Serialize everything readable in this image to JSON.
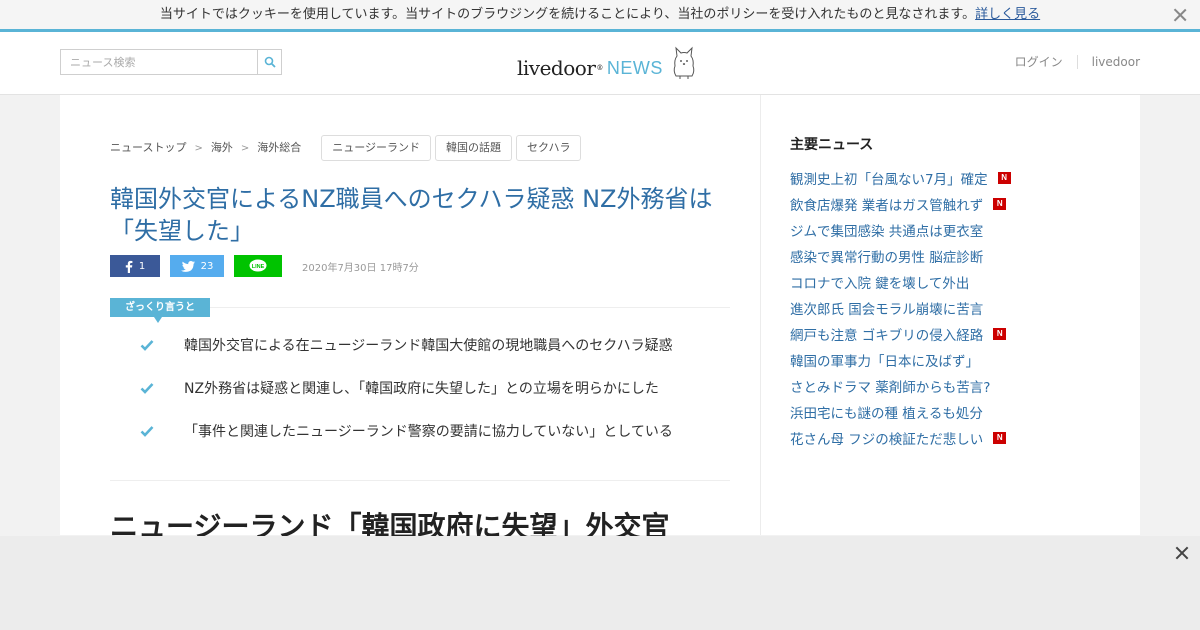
{
  "cookie_bar": {
    "text": "当サイトではクッキーを使用しています。当サイトのブラウジングを続けることにより、当社のポリシーを受け入れたものと見なされます。",
    "link": "詳しく見る"
  },
  "header": {
    "search_placeholder": "ニュース検索",
    "logo_main": "livedoor",
    "logo_sup": "®",
    "logo_news": "NEWS",
    "login": "ログイン",
    "livedoor_link": "livedoor"
  },
  "breadcrumb": [
    "ニューストップ",
    "海外",
    "海外総合"
  ],
  "tags": [
    "ニュージーランド",
    "韓国の話題",
    "セクハラ"
  ],
  "article": {
    "title": "韓国外交官によるNZ職員へのセクハラ疑惑 NZ外務省は「失望した」",
    "share": {
      "fb_count": "1",
      "tw_count": "23"
    },
    "date": "2020年7月30日 17時7分",
    "summary_label": "ざっくり言うと",
    "summary": [
      "韓国外交官による在ニュージーランド韓国大使館の現地職員へのセクハラ疑惑",
      "NZ外務省は疑惑と関連し、「韓国政府に失望した」との立場を明らかにした",
      "「事件と関連したニュージーランド警察の要請に協力していない」としている"
    ],
    "sub_heading": "ニュージーランド「韓国政府に失望」外交官"
  },
  "sidebar": {
    "title": "主要ニュース",
    "items": [
      {
        "text": "観測史上初「台風ない7月」確定",
        "new": true
      },
      {
        "text": "飲食店爆発 業者はガス管触れず",
        "new": true
      },
      {
        "text": "ジムで集団感染 共通点は更衣室",
        "new": false
      },
      {
        "text": "感染で異常行動の男性 脳症診断",
        "new": false
      },
      {
        "text": "コロナで入院 鍵を壊して外出",
        "new": false
      },
      {
        "text": "進次郎氏 国会モラル崩壊に苦言",
        "new": false
      },
      {
        "text": "網戸も注意 ゴキブリの侵入経路",
        "new": true
      },
      {
        "text": "韓国の軍事力「日本に及ばず」",
        "new": false
      },
      {
        "text": "さとみドラマ 薬剤師からも苦言?",
        "new": false
      },
      {
        "text": "浜田宅にも謎の種 植えるも処分",
        "new": false
      },
      {
        "text": "花さん母 フジの検証ただ悲しい",
        "new": true
      }
    ],
    "new_badge": "N"
  },
  "colors": {
    "accent": "#5ab4d6",
    "title_blue": "#2f6ea5",
    "facebook": "#3b5998",
    "twitter": "#55acee",
    "line": "#00c300",
    "new_badge": "#cc0000"
  }
}
